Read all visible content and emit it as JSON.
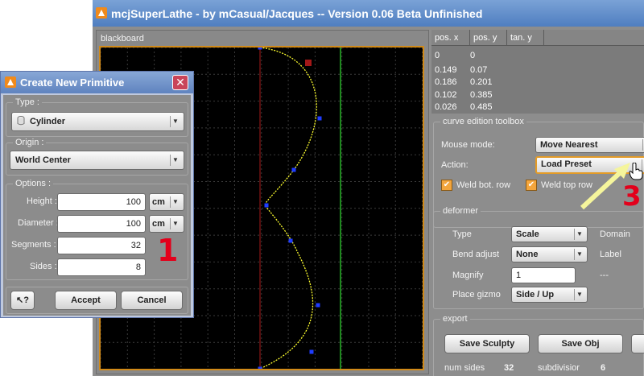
{
  "app": {
    "title": "mcjSuperLathe - by mCasual/Jacques -- Version 0.06 Beta Unfinished"
  },
  "blackboard": {
    "label": "blackboard"
  },
  "position_table": {
    "headers": [
      "pos. x",
      "pos. y",
      "tan. y"
    ],
    "rows": [
      [
        "0",
        "0"
      ],
      [
        "0.149",
        "0.07"
      ],
      [
        "0.186",
        "0.201"
      ],
      [
        "0.102",
        "0.385"
      ],
      [
        "0.026",
        "0.485"
      ]
    ]
  },
  "curve_toolbox": {
    "title": "curve edition toolbox",
    "mouse_mode_label": "Mouse mode:",
    "mouse_mode_value": "Move Nearest",
    "action_label": "Action:",
    "action_value": "Load Preset",
    "weld_bottom_label": "Weld bot. row",
    "weld_top_label": "Weld top row"
  },
  "deformer": {
    "title": "deformer",
    "type_label": "Type",
    "type_value": "Scale",
    "domain_label": "Domain",
    "bend_label": "Bend adjust",
    "bend_value": "None",
    "label_label": "Label",
    "magnify_label": "Magnify",
    "magnify_value": "1",
    "dash_value": "---",
    "gizmo_label": "Place gizmo",
    "gizmo_value": "Side / Up"
  },
  "export": {
    "title": "export",
    "save_sculpty": "Save Sculpty",
    "save_obj": "Save Obj",
    "num_sides_label": "num sides",
    "num_sides_value": "32",
    "subdivision_label": "subdivisior",
    "subdivision_value": "6"
  },
  "dialog": {
    "title": "Create New Primitive",
    "type_group": "Type :",
    "type_value": "Cylinder",
    "origin_group": "Origin :",
    "origin_value": "World Center",
    "options_group": "Options :",
    "height_label": "Height :",
    "height_value": "100",
    "height_unit": "cm",
    "diameter_label": "Diameter :",
    "diameter_value": "100",
    "diameter_unit": "cm",
    "segments_label": "Segments :",
    "segments_value": "32",
    "sides_label": "Sides :",
    "sides_value": "8",
    "help_label": "?",
    "accept_label": "Accept",
    "cancel_label": "Cancel"
  },
  "annotations": {
    "step1": "1",
    "step3": "3"
  },
  "icons": [
    "app-icon",
    "close-icon",
    "dropdown-arrow-icon",
    "check-icon",
    "help-cursor-icon",
    "hand-cursor-icon",
    "cylinder-icon"
  ],
  "colors": {
    "title_bar": "#4f7ec0",
    "canvas_border": "#d18a18",
    "curve": "#ffff2e",
    "control_point": "#1f3dff",
    "selected_point": "#a31818",
    "axis_red": "#aa1a1a",
    "axis_green": "#33e233",
    "annotation_red": "#e3001b",
    "arrow_yellow": "#f5f59c"
  }
}
